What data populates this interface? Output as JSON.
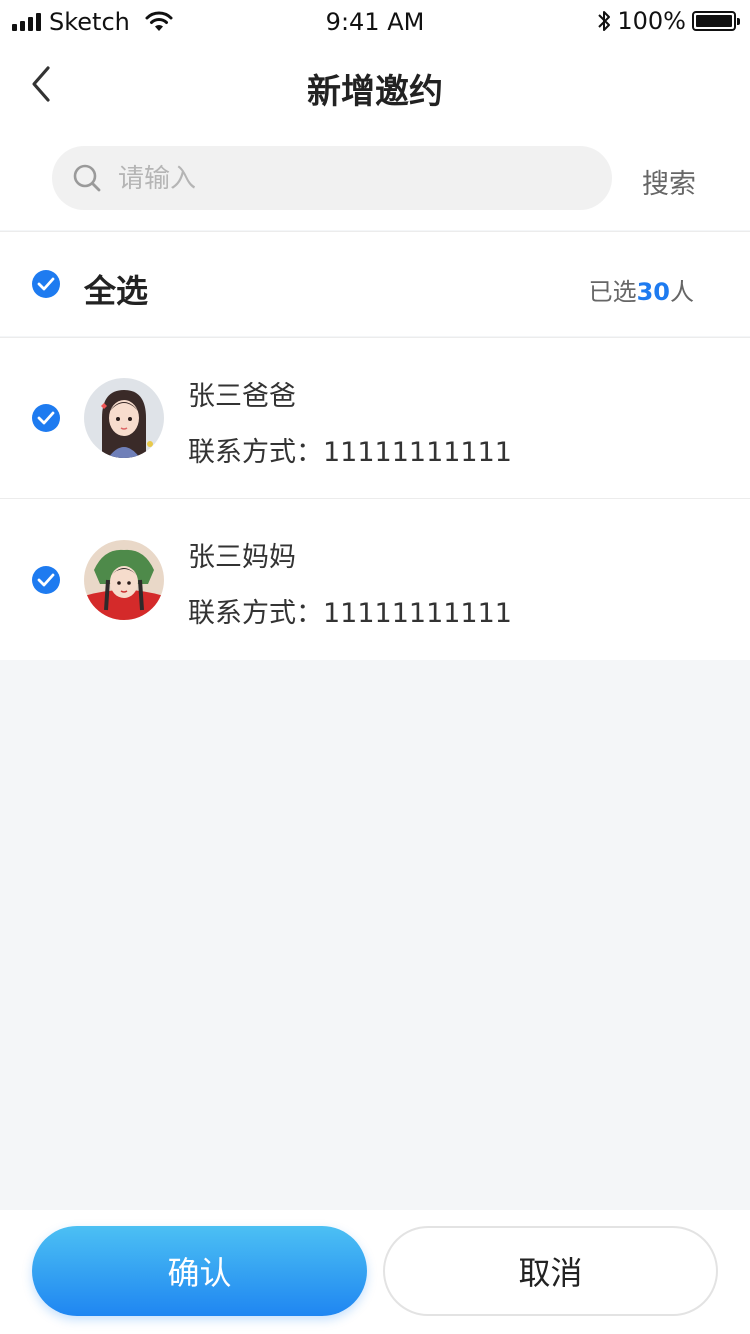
{
  "status_bar": {
    "carrier": "Sketch",
    "time": "9:41 AM",
    "battery_percent": "100%",
    "battery_level": 1.0
  },
  "nav": {
    "title": "新增邀约",
    "back_icon": "chevron-left-icon"
  },
  "search": {
    "placeholder": "请输入",
    "value": "",
    "button_label": "搜索",
    "icon": "search-icon"
  },
  "select_all": {
    "label": "全选",
    "checked": true,
    "count_prefix": "已选",
    "count": "30",
    "count_suffix": "人"
  },
  "contacts": [
    {
      "name": "张三爸爸",
      "phone_label": "联系方式：",
      "phone": "11111111111",
      "checked": true
    },
    {
      "name": "张三妈妈",
      "phone_label": "联系方式：",
      "phone": "11111111111",
      "checked": true
    }
  ],
  "buttons": {
    "confirm_label": "确认",
    "cancel_label": "取消"
  },
  "colors": {
    "accent": "#1e7bf0",
    "page_bg": "#f4f6f8"
  }
}
